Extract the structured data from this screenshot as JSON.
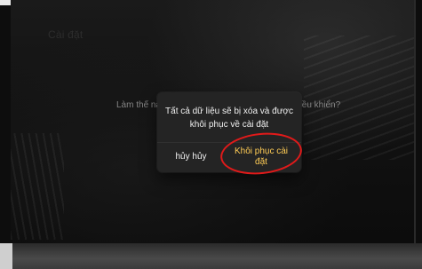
{
  "background": {
    "question_left": "Làm thế nào",
    "question_right": "điều khiển?",
    "faint_title": "Cài đặt"
  },
  "dialog": {
    "message": "Tất cả dữ liệu sẽ bị xóa và được khôi phục về cài đặt",
    "cancel_label": "hủy hủy",
    "restore_label": "Khôi phục cài đặt"
  },
  "colors": {
    "restore_text": "#ffcc55",
    "annotation_red": "#e01a1a",
    "dialog_bg": "#242424"
  }
}
